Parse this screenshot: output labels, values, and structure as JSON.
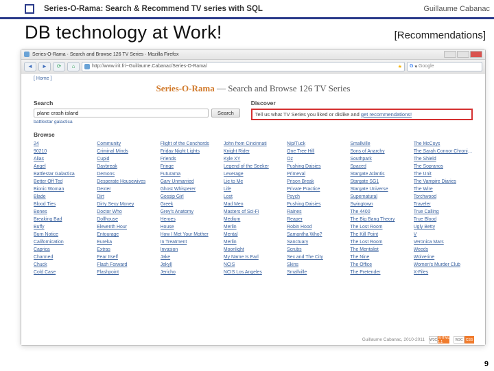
{
  "header": {
    "title": "Series-O-Rama: Search & Recommend TV series with SQL",
    "author": "Guillaume Cabanac"
  },
  "headline": "DB technology at Work!",
  "section_tag": "[Recommendations]",
  "slide_number": "9",
  "browser": {
    "tab_title": "Series-O-Rama · Search and Browse 126 TV Series · Mozilla Firefox",
    "url": "http://www.irit.fr/~Guillaume.Cabanac/Series-O-Rama/",
    "search_placeholder": "Google",
    "menu_home": "[ Home ]"
  },
  "page": {
    "brand": "Series-O-Rama",
    "tagline": " — Search and Browse 126 TV Series",
    "search_heading": "Search",
    "search_query": "plane crash island",
    "search_button": "Search",
    "suggestion": "battlestar galactica",
    "discover_heading": "Discover",
    "discover_text_pre": "Tell us what TV Series you liked or dislike and ",
    "discover_link": "get recommendations!",
    "browse_heading": "Browse",
    "footer_credit": "Guillaume Cabanac, 2010-2011",
    "badge1_l": "W3C",
    "badge1_r": "XHTML 1.1",
    "badge2_l": "W3C",
    "badge2_r": "CSS"
  },
  "series": [
    "24",
    "Community",
    "Flight of the Conchords",
    "John from Cincinnati",
    "Nip/Tuck",
    "Smallville",
    "The McCoys",
    "90210",
    "Criminal Minds",
    "Friday Night Lights",
    "Knight Rider",
    "One Tree Hill",
    "Sons of Anarchy",
    "The Sarah Connor Chronicles",
    "Alias",
    "Cupid",
    "Friends",
    "Kyle XY",
    "Oz",
    "Southpark",
    "The Shield",
    "Angel",
    "Daybreak",
    "Fringe",
    "Legend of the Seeker",
    "Pushing Daisies",
    "Spaced",
    "The Sopranos",
    "Battlestar Galactica",
    "Demons",
    "Futurama",
    "Leverage",
    "Primeval",
    "Stargate Atlantis",
    "The Unit",
    "Better Off Ted",
    "Desperate Housewives",
    "Gary Unmarried",
    "Lie to Me",
    "Prison Break",
    "Stargate SG1",
    "The Vampire Diaries",
    "Bionic Woman",
    "Dexter",
    "Ghost Whisperer",
    "Life",
    "Private Practice",
    "Stargate Universe",
    "The Wire",
    "Blade",
    "Dirt",
    "Gossip Girl",
    "Lost",
    "Psych",
    "Supernatural",
    "Torchwood",
    "Blood Ties",
    "Dirty Sexy Money",
    "Greek",
    "Mad Men",
    "Pushing Daisies",
    "Swingtown",
    "Traveler",
    "Bones",
    "Doctor Who",
    "Grey's Anatomy",
    "Masters of Sci-Fi",
    "Raines",
    "The 4400",
    "True Calling",
    "Breaking Bad",
    "Dollhouse",
    "Heroes",
    "Medium",
    "Reaper",
    "The Big Bang Theory",
    "True Blood",
    "Buffy",
    "Eleventh Hour",
    "House",
    "Merlin",
    "Robin Hood",
    "The Lost Room",
    "Ugly Betty",
    "Burn Notice",
    "Entourage",
    "How I Met Your Mother",
    "Mental",
    "Samantha Who?",
    "The Kill Point",
    "V",
    "Californication",
    "Eureka",
    "In Treatment",
    "Merlin",
    "Sanctuary",
    "The Lost Room",
    "Veronica Mars",
    "Caprica",
    "Extras",
    "Invasion",
    "Moonlight",
    "Scrubs",
    "The Mentalist",
    "Weeds",
    "Charmed",
    "Fear Itself",
    "Jake",
    "My Name Is Earl",
    "Sex and The City",
    "The Nine",
    "Wolverine",
    "Chuck",
    "Flash Forward",
    "Jekyll",
    "NCIS",
    "Skins",
    "The Office",
    "Women's Murder Club",
    "Cold Case",
    "Flashpoint",
    "Jericho",
    "NCIS Los Angeles",
    "Smallville",
    "The Pretender",
    "X-Files"
  ]
}
